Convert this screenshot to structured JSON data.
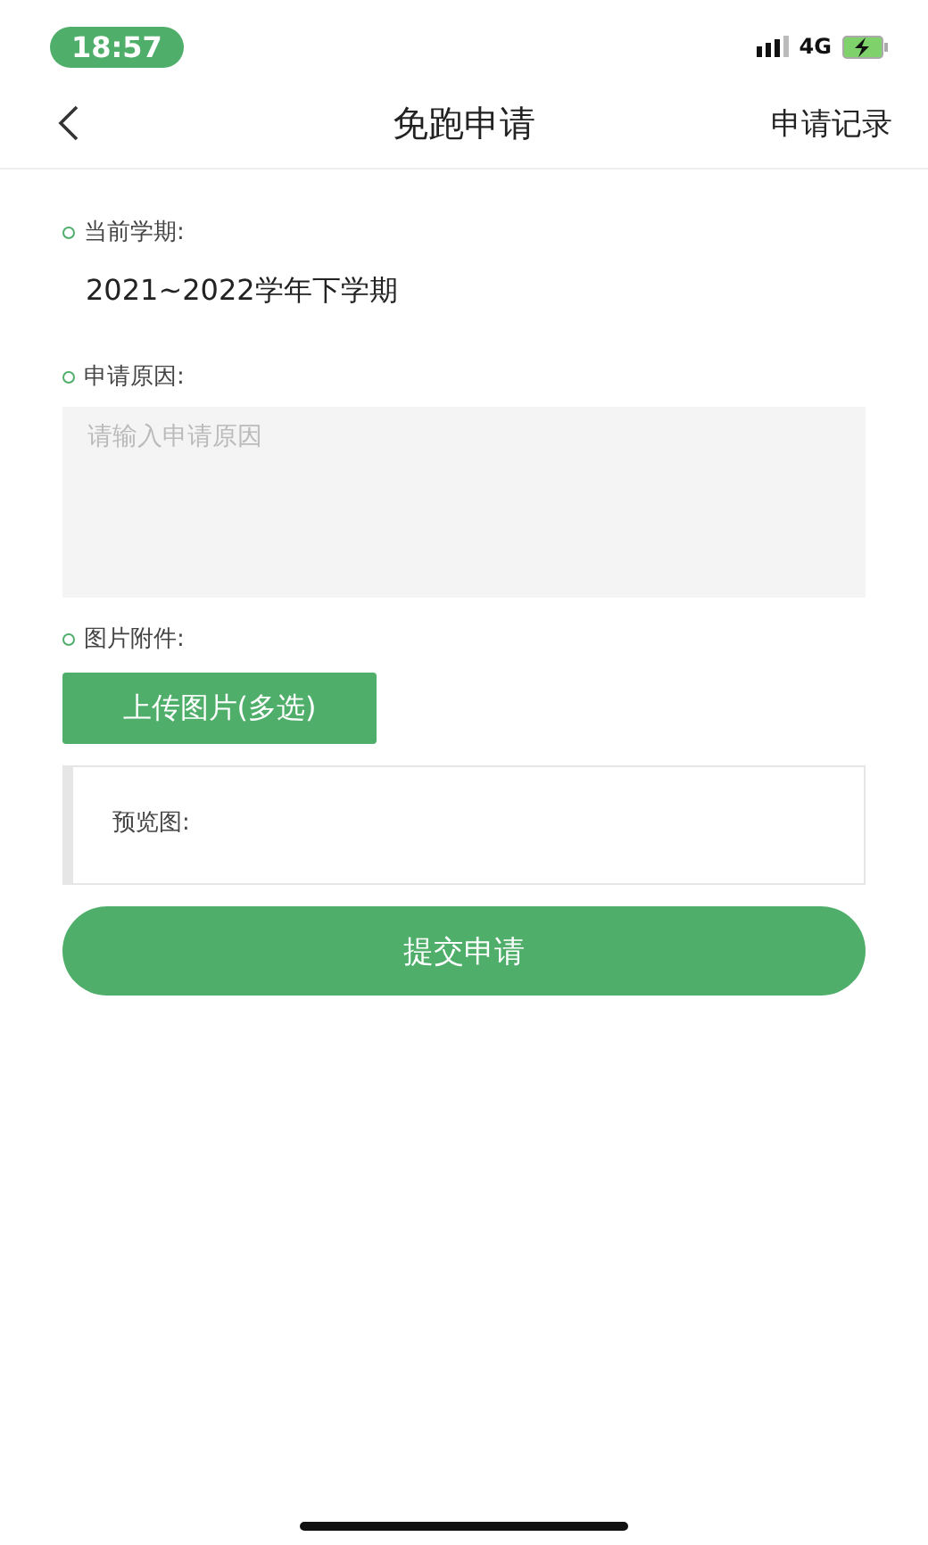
{
  "status_bar": {
    "time": "18:57",
    "network": "4G"
  },
  "nav": {
    "title": "免跑申请",
    "action": "申请记录"
  },
  "form": {
    "sections": [
      {
        "kind": "text",
        "label": "当前学期:",
        "value": "2021~2022学年下学期"
      },
      {
        "kind": "textarea",
        "label": "申请原因:",
        "placeholder": "请输入申请原因"
      },
      {
        "kind": "upload",
        "label": "图片附件:",
        "button": "上传图片(多选)",
        "preview_label": "预览图:"
      }
    ]
  },
  "submit": "提交申请"
}
